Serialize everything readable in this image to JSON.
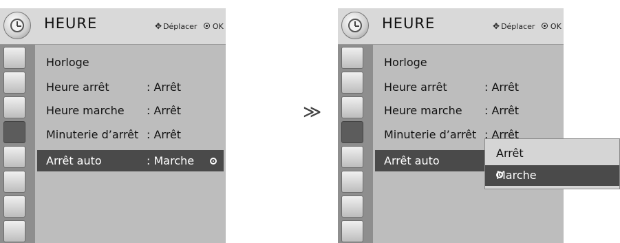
{
  "left": {
    "title": "HEURE",
    "nav_move": "Déplacer",
    "nav_ok": "OK",
    "rows": [
      {
        "label": "Horloge",
        "value": ""
      },
      {
        "label": "Heure arrêt",
        "value": ": Arrêt"
      },
      {
        "label": "Heure marche",
        "value": ": Arrêt"
      },
      {
        "label": "Minuterie d’arrêt",
        "value": ": Arrêt"
      },
      {
        "label": "Arrêt auto",
        "value": ": Marche"
      }
    ]
  },
  "right": {
    "title": "HEURE",
    "nav_move": "Déplacer",
    "nav_ok": "OK",
    "rows": [
      {
        "label": "Horloge",
        "value": ""
      },
      {
        "label": "Heure arrêt",
        "value": ": Arrêt"
      },
      {
        "label": "Heure marche",
        "value": ": Arrêt"
      },
      {
        "label": "Minuterie d’arrêt",
        "value": ": Arrêt"
      },
      {
        "label": "Arrêt auto",
        "value": ""
      }
    ],
    "popup_options": [
      "Arrêt",
      "Marche"
    ]
  },
  "arrow_glyph": "≫",
  "sidebar_icons": [
    "picture-icon",
    "screen-icon",
    "speaker-icon",
    "clock-icon",
    "option-icon",
    "lock-icon",
    "input-icon",
    "usb-photo-icon"
  ],
  "colors": {
    "panel": "#bdbdbd",
    "highlight": "#4a4a4a",
    "sidebar": "#8e8e8e"
  }
}
